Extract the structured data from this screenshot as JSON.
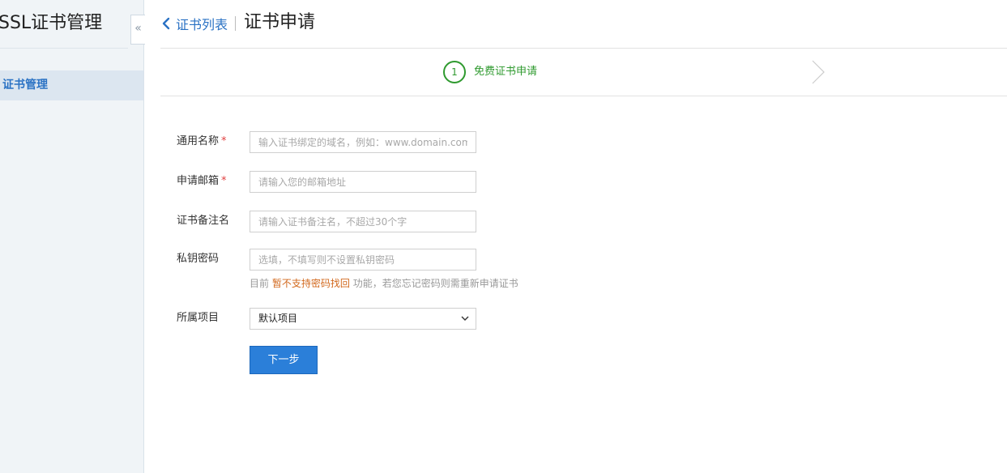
{
  "sidebar": {
    "title": "SSL证书管理",
    "collapse_icon": "«",
    "items": [
      {
        "label": "证书管理",
        "active": true
      }
    ]
  },
  "header": {
    "back_label": "证书列表",
    "title": "证书申请"
  },
  "steps": [
    {
      "number": "1",
      "label": "免费证书申请",
      "status": "active"
    }
  ],
  "form": {
    "common_name": {
      "label": "通用名称",
      "required_mark": "*",
      "placeholder": "输入证书绑定的域名，例如：www.domain.com"
    },
    "email": {
      "label": "申请邮箱",
      "required_mark": "*",
      "placeholder": "请输入您的邮箱地址"
    },
    "remark": {
      "label": "证书备注名",
      "placeholder": "请输入证书备注名，不超过30个字"
    },
    "private_key_password": {
      "label": "私钥密码",
      "placeholder": "选填，不填写则不设置私钥密码"
    },
    "password_hint": {
      "prefix": "目前",
      "warning": "暂不支持密码找回",
      "suffix": "功能，若您忘记密码则需重新申请证书"
    },
    "project": {
      "label": "所属项目",
      "selected": "默认项目"
    },
    "next_button": "下一步"
  },
  "colors": {
    "accent": "#2a72c4",
    "step_active": "#2f9a2f",
    "required": "#e04040",
    "warning": "#d2691e",
    "button": "#2b7fd9"
  }
}
